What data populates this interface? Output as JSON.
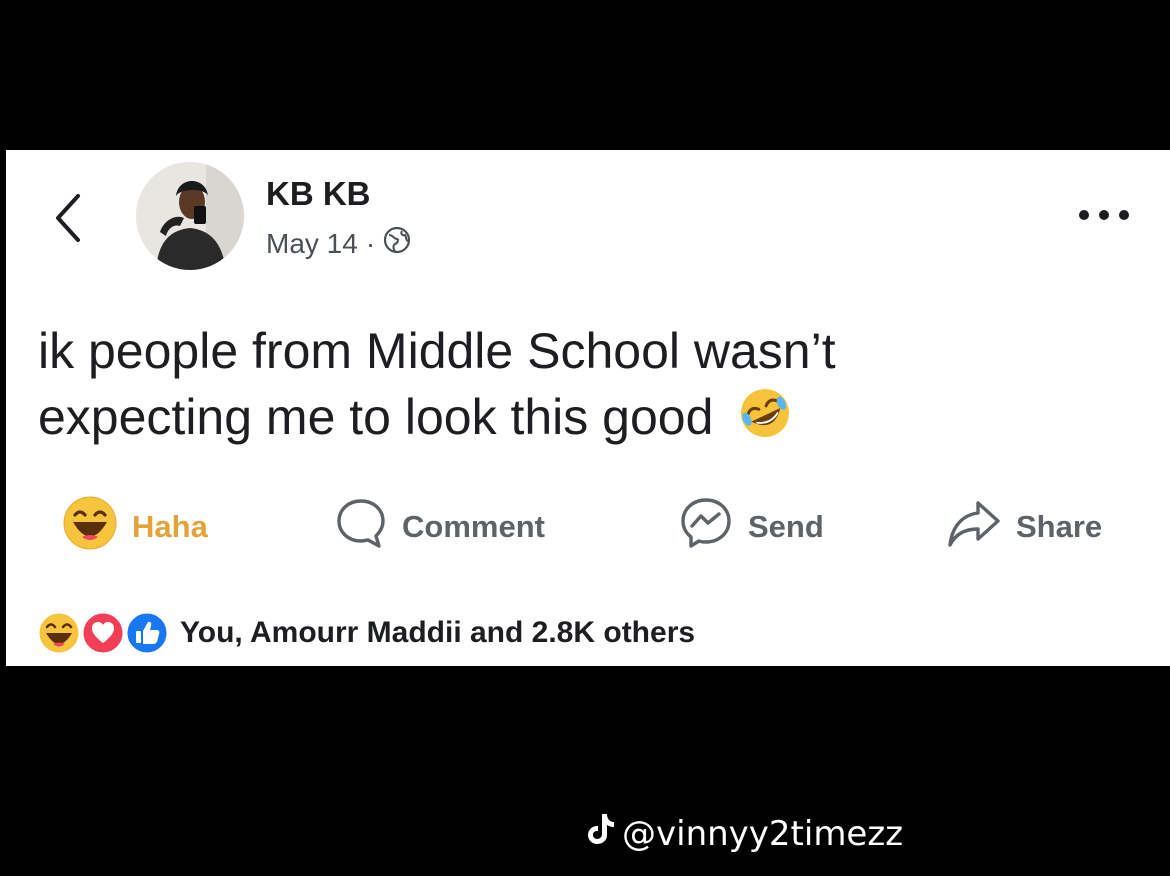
{
  "post": {
    "author": "KB KB",
    "date": "May 14",
    "separator": "·",
    "privacy_icon": "globe-icon",
    "text": "ik people from Middle School wasn’t expecting me to look this good",
    "emoji": "rolling-on-floor-laughing-emoji"
  },
  "actions": {
    "haha_label": "Haha",
    "comment_label": "Comment",
    "send_label": "Send",
    "share_label": "Share"
  },
  "reactions": {
    "icons": [
      "haha-icon",
      "love-icon",
      "like-icon"
    ],
    "summary": "You, Amourr Maddii and 2.8K others"
  },
  "watermark": {
    "platform_icon": "tiktok-icon",
    "handle": "@vinnyy2timezz"
  },
  "colors": {
    "haha": "#e2a33a",
    "like": "#1877f2",
    "love": "#f33e58",
    "text": "#1c1e21",
    "muted": "#5e6369"
  }
}
